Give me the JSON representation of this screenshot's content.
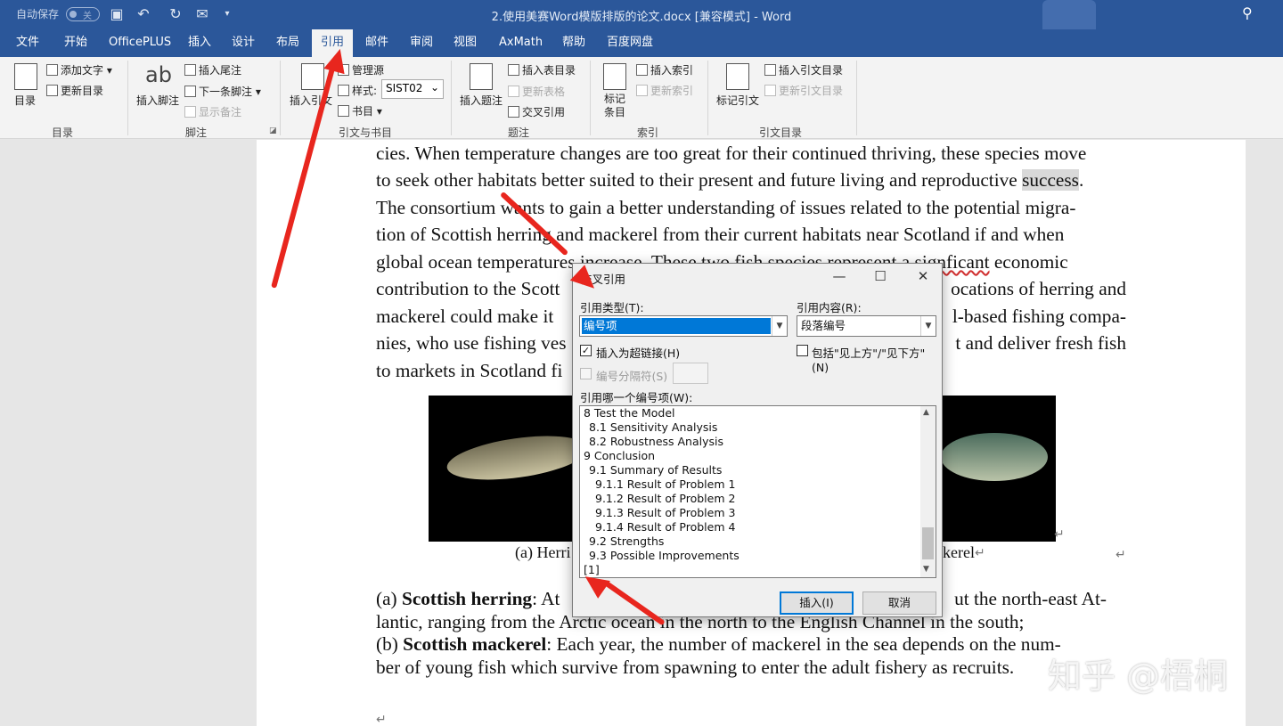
{
  "titlebar": {
    "autosave": "自动保存",
    "autosave_state": "关",
    "doc_title": "2.使用美赛Word模版排版的论文.docx [兼容模式] - Word"
  },
  "tabs": [
    "文件",
    "开始",
    "OfficePLUS",
    "插入",
    "设计",
    "布局",
    "引用",
    "邮件",
    "审阅",
    "视图",
    "AxMath",
    "帮助",
    "百度网盘"
  ],
  "active_tab": "引用",
  "ribbon": {
    "toc": {
      "big": "目录",
      "add_text": "添加文字",
      "update": "更新目录",
      "label": "目录"
    },
    "footnote": {
      "big": "插入脚注",
      "insert_endnote": "插入尾注",
      "next_footnote": "下一条脚注",
      "show_notes": "显示备注",
      "label": "脚注"
    },
    "citation": {
      "big": "插入引文",
      "manage": "管理源",
      "style_label": "样式:",
      "style_value": "SIST02",
      "bibliography": "书目",
      "label": "引文与书目"
    },
    "caption": {
      "big": "插入题注",
      "insert_table": "插入表目录",
      "update_table": "更新表格",
      "cross_ref": "交叉引用",
      "label": "题注"
    },
    "index": {
      "big": "标记条目",
      "insert_index": "插入索引",
      "update_index": "更新索引",
      "label": "索引"
    },
    "toa": {
      "big": "标记引文",
      "insert_toa": "插入引文目录",
      "update_toa": "更新引文目录",
      "label": "引文目录"
    }
  },
  "document": {
    "lines": [
      "cies. When temperature changes are too great for their continued thriving, these species move",
      "to seek other habitats better suited to their present and future living and reproductive",
      "The consortium wants to gain a better understanding of issues related to the potential migra-",
      "tion of Scottish herring and mackerel from their current habitats near Scotland if and when",
      "global ocean temperatures increase. These two fish species represent a",
      "contribution to the Scott",
      "mackerel could make it",
      "nies, who use fishing ves",
      "to markets in Scotland fi"
    ],
    "highlight_word": "success",
    "line5_tail_misspelled": "signficant",
    "line5_end": "economic",
    "line6_right": "ocations of herring and",
    "line7_right": "l-based fishing compa-",
    "line8_right": "t and deliver fresh fish",
    "caption_left": "(a) Herri",
    "caption_right": "kerel",
    "bullet_a_prefix": "(a) ",
    "bullet_a_bold": "Scottish herring",
    "bullet_a_rest": ": At",
    "bullet_a_right": "ut the north-east At-",
    "bullet_a_line2": "lantic, ranging from the Arctic ocean in the north to the English Channel in the south;",
    "bullet_b_prefix": "(b) ",
    "bullet_b_bold": "Scottish mackerel",
    "bullet_b_rest": ": Each year, the number of mackerel in the sea depends on the num-",
    "bullet_b_line2": "ber of young fish which survive from spawning to enter the adult fishery as recruits."
  },
  "dialog": {
    "title": "交叉引用",
    "ref_type_label": "引用类型(T):",
    "ref_type_value": "编号项",
    "ref_content_label": "引用内容(R):",
    "ref_content_value": "段落编号",
    "insert_hyperlink": "插入为超链接(H)",
    "include_above_below": "包括\"见上方\"/\"见下方\"(N)",
    "number_separator": "编号分隔符(S)",
    "which_item_label": "引用哪一个编号项(W):",
    "items": [
      "8 Test the Model",
      "  8.1 Sensitivity Analysis",
      "  8.2 Robustness Analysis",
      "9 Conclusion",
      "  9.1 Summary of Results",
      "    9.1.1 Result of Problem 1",
      "    9.1.2 Result of Problem 2",
      "    9.1.3 Result of Problem 3",
      "    9.1.4 Result of Problem 4",
      "  9.2 Strengths",
      "  9.3 Possible Improvements",
      "[1]"
    ],
    "insert_button": "插入(I)",
    "cancel_button": "取消"
  },
  "watermark": "知乎 @梧桐"
}
